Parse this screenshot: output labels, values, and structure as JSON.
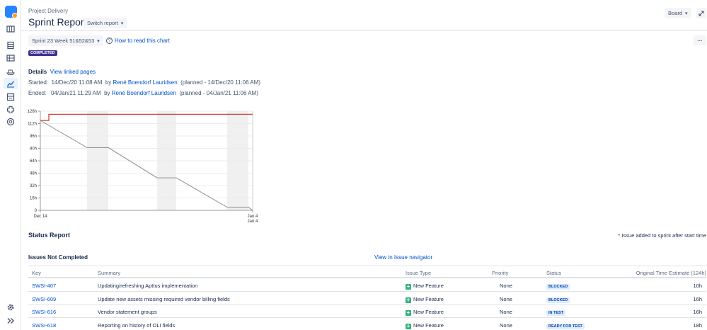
{
  "header": {
    "breadcrumb": "Project Delivery",
    "title": "Sprint Report",
    "switch_label": "Switch report",
    "board_label": "Board"
  },
  "toolbar": {
    "sprint_select": "Sprint 23 Week 51&52&53",
    "help_link": "How to read this chart",
    "status_badge": "COMPLETED"
  },
  "details": {
    "title": "Details",
    "linked_pages": "View linked pages",
    "started_label": "Started:",
    "started_value": "14/Dec/20 11:08 AM",
    "started_by": "by",
    "started_user": "René Boendorf Lauridsen",
    "started_planned": "(planned - 14/Dec/20 11:06 AM)",
    "ended_label": "Ended:",
    "ended_value": "04/Jan/21 11:29 AM",
    "ended_by": "by",
    "ended_user": "René Boendorf Lauridsen",
    "ended_planned": "(planned - 04/Jan/21 11:06 AM)"
  },
  "chart_data": {
    "type": "line",
    "y_ticks": [
      "0",
      "16h",
      "32h",
      "48h",
      "64h",
      "80h",
      "96h",
      "112h",
      "128h"
    ],
    "y_range": [
      0,
      128
    ],
    "x_labels": [
      "Dec 14",
      "Jan 4"
    ],
    "x_label_second": "Jan 4",
    "series": [
      {
        "color": "#d04437",
        "points": [
          [
            0,
            116
          ],
          [
            0.04,
            116
          ],
          [
            0.04,
            124
          ],
          [
            1,
            124
          ]
        ]
      },
      {
        "color": "#8c8c8c",
        "points": [
          [
            0,
            116
          ],
          [
            0.22,
            81
          ],
          [
            0.32,
            81
          ],
          [
            0.55,
            42
          ],
          [
            0.64,
            42
          ],
          [
            0.88,
            4
          ],
          [
            0.98,
            4
          ],
          [
            1,
            0
          ]
        ]
      }
    ],
    "nonworking_bands": [
      [
        0.22,
        0.32
      ],
      [
        0.55,
        0.64
      ],
      [
        0.88,
        0.98
      ]
    ],
    "grid": true
  },
  "status_report": {
    "title": "Status Report",
    "note": "* Issue added to sprint after start time",
    "section_title": "Issues Not Completed",
    "navigator_link": "View in Issue navigator",
    "columns": [
      "Key",
      "Summary",
      "Issue Type",
      "Priority",
      "Status",
      "Original Time Estimate (124h)"
    ],
    "rows": [
      {
        "key": "SWSI-407",
        "summary": "Updating/refreshing Apttus implementation",
        "type": "New Feature",
        "priority": "None",
        "status": "BLOCKED",
        "estimate": "10h"
      },
      {
        "key": "SWSI-609",
        "summary": "Update new assets missing required vendor billing fields",
        "type": "New Feature",
        "priority": "None",
        "status": "BLOCKED",
        "estimate": "16h"
      },
      {
        "key": "SWSI-616",
        "summary": "Vendor statement groups",
        "type": "New Feature",
        "priority": "None",
        "status": "IN TEST",
        "estimate": "16h"
      },
      {
        "key": "SWSI-618",
        "summary": "Reporting on history of OLI fields",
        "type": "New Feature",
        "priority": "None",
        "status": "READY FOR TEST",
        "estimate": "18h"
      }
    ]
  },
  "nav_icons": [
    "board-icon",
    "backlog-icon",
    "list-icon",
    "ship-icon",
    "reports-icon",
    "releases-icon",
    "components-icon",
    "settings-icon"
  ]
}
